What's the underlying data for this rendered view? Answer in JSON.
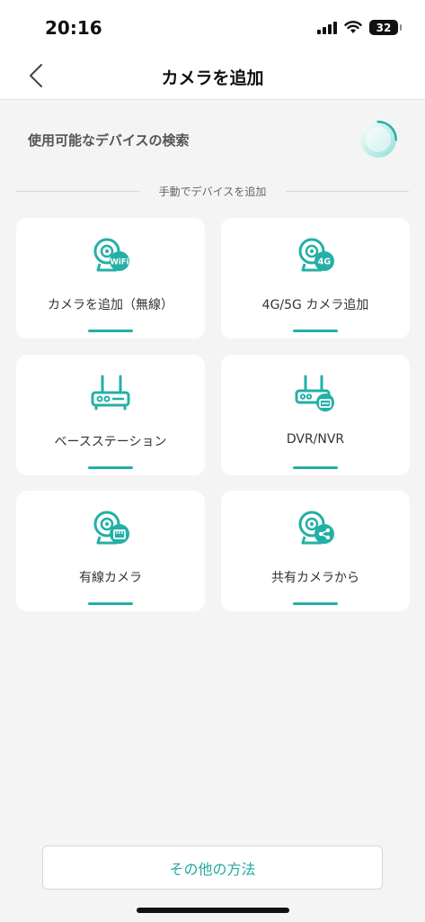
{
  "status_bar": {
    "time": "20:16",
    "battery": "32"
  },
  "nav": {
    "title": "カメラを追加"
  },
  "search": {
    "label": "使用可能なデバイスの検索"
  },
  "divider": {
    "text": "手動でデバイスを追加"
  },
  "cards": [
    {
      "label": "カメラを追加（無線）",
      "icon": "wifi-camera-icon",
      "badge": "WiFi"
    },
    {
      "label": "4G/5G カメラ追加",
      "icon": "4g-camera-icon",
      "badge": "4G"
    },
    {
      "label": "ベースステーション",
      "icon": "base-station-icon"
    },
    {
      "label": "DVR/NVR",
      "icon": "dvr-nvr-icon"
    },
    {
      "label": "有線カメラ",
      "icon": "wired-camera-icon"
    },
    {
      "label": "共有カメラから",
      "icon": "shared-camera-icon"
    }
  ],
  "footer": {
    "other_methods": "その他の方法"
  },
  "colors": {
    "accent": "#23b0a5",
    "background": "#f4f4f4"
  }
}
